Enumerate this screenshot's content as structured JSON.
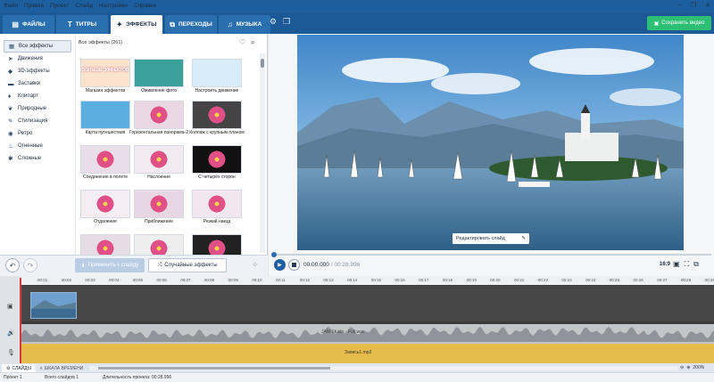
{
  "menu": [
    "Файл",
    "Правка",
    "Проект",
    "Слайд",
    "Настройки",
    "Справка"
  ],
  "tabs": [
    {
      "label": "ФАЙЛЫ",
      "icon": "folder-icon",
      "glyph": "▤"
    },
    {
      "label": "ТИТРЫ",
      "icon": "titles-icon",
      "glyph": "T"
    },
    {
      "label": "ЭФФЕКТЫ",
      "icon": "effects-icon",
      "glyph": "✦"
    },
    {
      "label": "ПЕРЕХОДЫ",
      "icon": "transitions-icon",
      "glyph": "⧉"
    },
    {
      "label": "МУЗЫКА",
      "icon": "music-icon",
      "glyph": "♫"
    }
  ],
  "save_label": "Сохранить видео",
  "categories": [
    {
      "label": "Все эффекты",
      "icon": "grid-icon",
      "glyph": "▦"
    },
    {
      "label": "Движения",
      "icon": "motion-icon",
      "glyph": "➤"
    },
    {
      "label": "3D-эффекты",
      "icon": "cube-icon",
      "glyph": "◆"
    },
    {
      "label": "Заставки",
      "icon": "intro-icon",
      "glyph": "▬"
    },
    {
      "label": "Клипарт",
      "icon": "clipart-icon",
      "glyph": "♦"
    },
    {
      "label": "Природные",
      "icon": "leaf-icon",
      "glyph": "❦"
    },
    {
      "label": "Стилизация",
      "icon": "brush-icon",
      "glyph": "✎"
    },
    {
      "label": "Ретро",
      "icon": "camera-icon",
      "glyph": "◉"
    },
    {
      "label": "Огненные",
      "icon": "fire-icon",
      "glyph": "♨"
    },
    {
      "label": "Сложные",
      "icon": "complex-icon",
      "glyph": "✱"
    }
  ],
  "grid_title": "Все эффекты (261)",
  "effects": [
    "Магазин эффектов",
    "Оживление фото",
    "Настроить движение",
    "Карта путешествия",
    "Горизонтальная панорама-2",
    "Коллаж с крупным планом",
    "Соединение в полете",
    "Наслоение",
    "С четырёх сторон",
    "Отдаление",
    "Приближение",
    "Резкий наезд",
    "",
    "",
    ""
  ],
  "store_thumb_text": "БОЛЬШЕ ЭФФЕКТОВ",
  "apply_label": "Применить к слайду",
  "random_label": "Случайные эффекты",
  "edit_slide_label": "Редактировать слайд",
  "time_current": "00:00.000",
  "time_total": "/ 00:28.996",
  "ratio": "16:9",
  "ruler_ticks": [
    "00:01",
    "00:02",
    "00:03",
    "00:04",
    "00:05",
    "00:06",
    "00:07",
    "00:08",
    "00:09",
    "00:10",
    "00:11",
    "00:12",
    "00:13",
    "00:14",
    "00:15",
    "00:16",
    "00:17",
    "00:18",
    "00:19",
    "00:20",
    "00:21",
    "00:22",
    "00:23",
    "00:24",
    "00:25",
    "00:26",
    "00:27",
    "00:28",
    "00:29"
  ],
  "audio_track": "JAM Studio - Full.wav",
  "music_track": "Запись1.mp3",
  "bottom_tabs": {
    "slides": "СЛАЙДЫ",
    "timeline": "ШКАЛА ВРЕМЕНИ"
  },
  "zoom": "200%",
  "status": {
    "project": "Проект 1",
    "slides": "Всего слайдов 1",
    "duration": "Длительность проекта: 00:28.996"
  },
  "colors": {
    "titlebar": "#1d5f9e",
    "accent": "#2b6db5",
    "save": "#2dbf74",
    "music": "#e6bd4b"
  }
}
